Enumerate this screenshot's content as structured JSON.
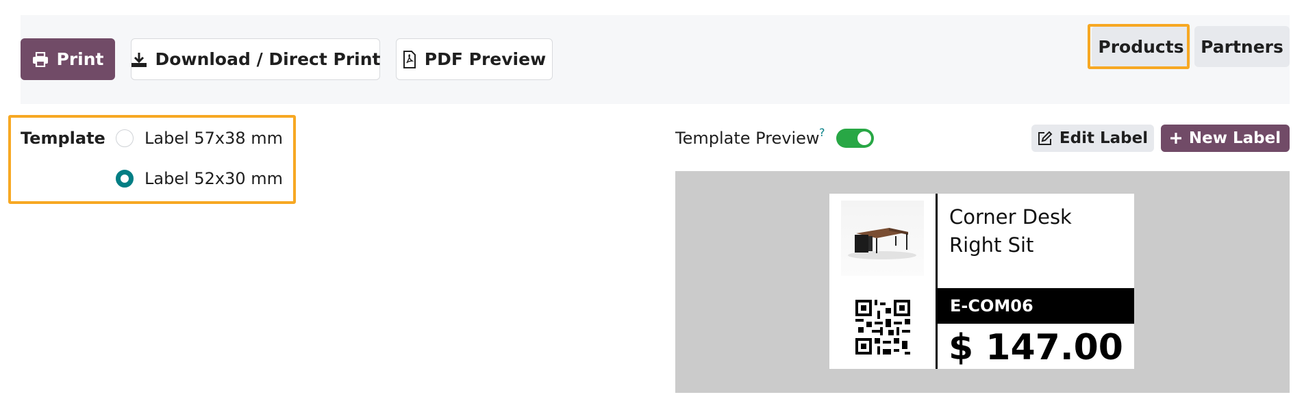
{
  "toolbar": {
    "print_label": "Print",
    "download_label": "Download / Direct Print",
    "pdf_preview_label": "PDF Preview",
    "products_label": "Products",
    "partners_label": "Partners"
  },
  "template": {
    "label": "Template",
    "options": [
      {
        "label": "Label 57x38 mm",
        "selected": false
      },
      {
        "label": "Label 52x30 mm",
        "selected": true
      }
    ]
  },
  "preview": {
    "title": "Template Preview",
    "help_marker": "?",
    "toggle_on": true,
    "edit_label": "Edit Label",
    "new_label": "New Label"
  },
  "label": {
    "product_name": "Corner Desk Right Sit",
    "code": "E-COM06",
    "price": "$ 147.00"
  },
  "icons": {
    "print": "printer-icon",
    "download": "download-icon",
    "pdf": "pdf-file-icon",
    "edit": "edit-icon",
    "new": "plus-icon"
  },
  "colors": {
    "primary": "#714b67",
    "accent_teal": "#017e84",
    "toggle_green": "#28a745",
    "highlight_orange": "#f7a823",
    "preview_bg": "#cbcbcb"
  }
}
